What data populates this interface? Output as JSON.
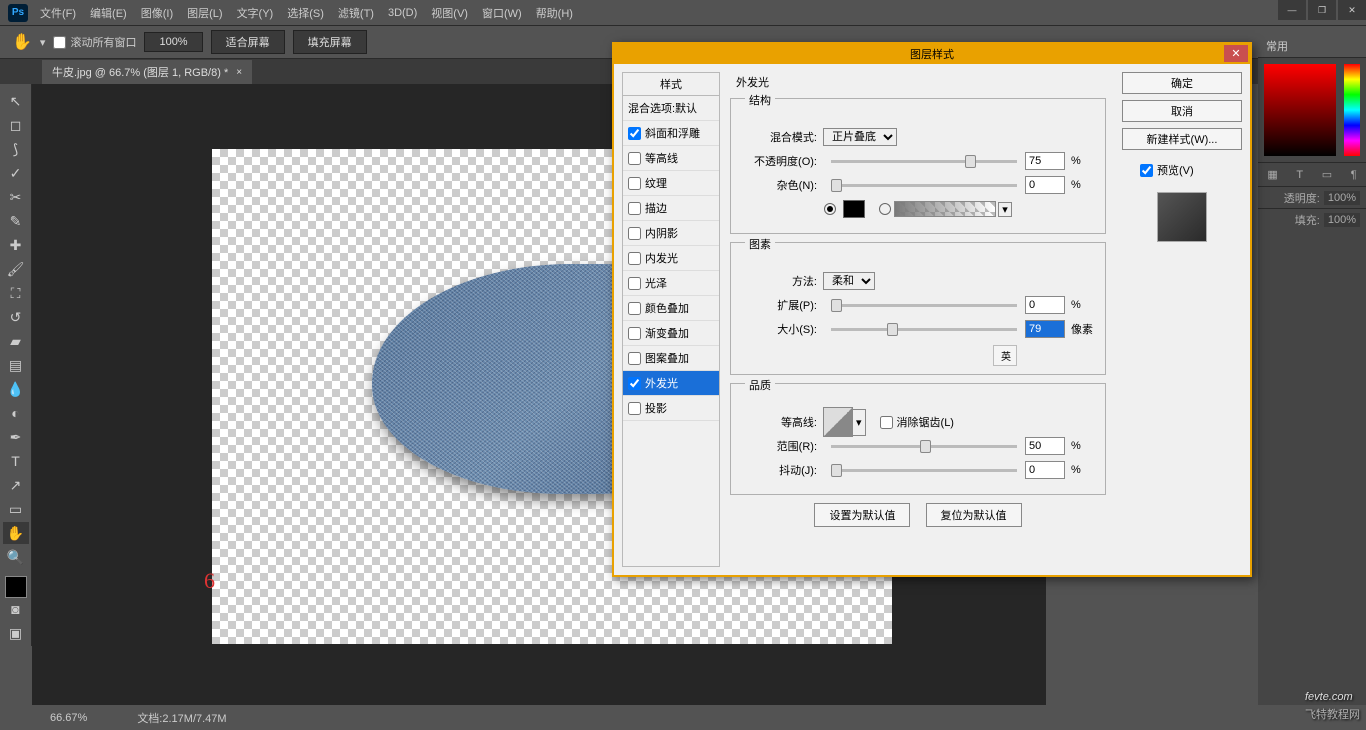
{
  "menu": {
    "items": [
      "文件(F)",
      "编辑(E)",
      "图像(I)",
      "图层(L)",
      "文字(Y)",
      "选择(S)",
      "滤镜(T)",
      "3D(D)",
      "视图(V)",
      "窗口(W)",
      "帮助(H)"
    ]
  },
  "optbar": {
    "scroll_all": "滚动所有窗口",
    "zoom": "100%",
    "fit": "适合屏幕",
    "fill": "填充屏幕"
  },
  "doc": {
    "tab": "牛皮.jpg @ 66.7% (图层 1, RGB/8) *"
  },
  "status": {
    "zoom": "66.67%",
    "doc": "文档:2.17M/7.47M"
  },
  "rpanel": {
    "tab": "常用",
    "opacity_lbl": "透明度:",
    "opacity": "100%",
    "fill_lbl": "填充:",
    "fill": "100%"
  },
  "dlg": {
    "title": "图层样式",
    "ok": "确定",
    "cancel": "取消",
    "newstyle": "新建样式(W)...",
    "preview": "预览(V)",
    "styles_hdr": "样式",
    "blend_def": "混合选项:默认",
    "items": [
      "斜面和浮雕",
      "等高线",
      "纹理",
      "描边",
      "内阴影",
      "内发光",
      "光泽",
      "颜色叠加",
      "渐变叠加",
      "图案叠加",
      "外发光",
      "投影"
    ],
    "checked": {
      "bevel": true,
      "outerglow": true
    },
    "section": "外发光",
    "structure": "结构",
    "blendmode_lbl": "混合模式:",
    "blendmode": "正片叠底",
    "opacity_lbl": "不透明度(O):",
    "opacity": "75",
    "pct": "%",
    "noise_lbl": "杂色(N):",
    "noise": "0",
    "element": "图素",
    "method_lbl": "方法:",
    "method": "柔和",
    "spread_lbl": "扩展(P):",
    "spread": "0",
    "size_lbl": "大小(S):",
    "size": "79",
    "px": "像素",
    "quality": "品质",
    "contour_lbl": "等高线:",
    "antialias": "消除锯齿(L)",
    "range_lbl": "范围(R):",
    "range": "50",
    "jitter_lbl": "抖动(J):",
    "jitter": "0",
    "reset": "设置为默认值",
    "revert": "复位为默认值",
    "ime": "英"
  },
  "watermark": {
    "main": "fevte.com",
    "sub": "飞特教程网"
  },
  "marker": "6"
}
